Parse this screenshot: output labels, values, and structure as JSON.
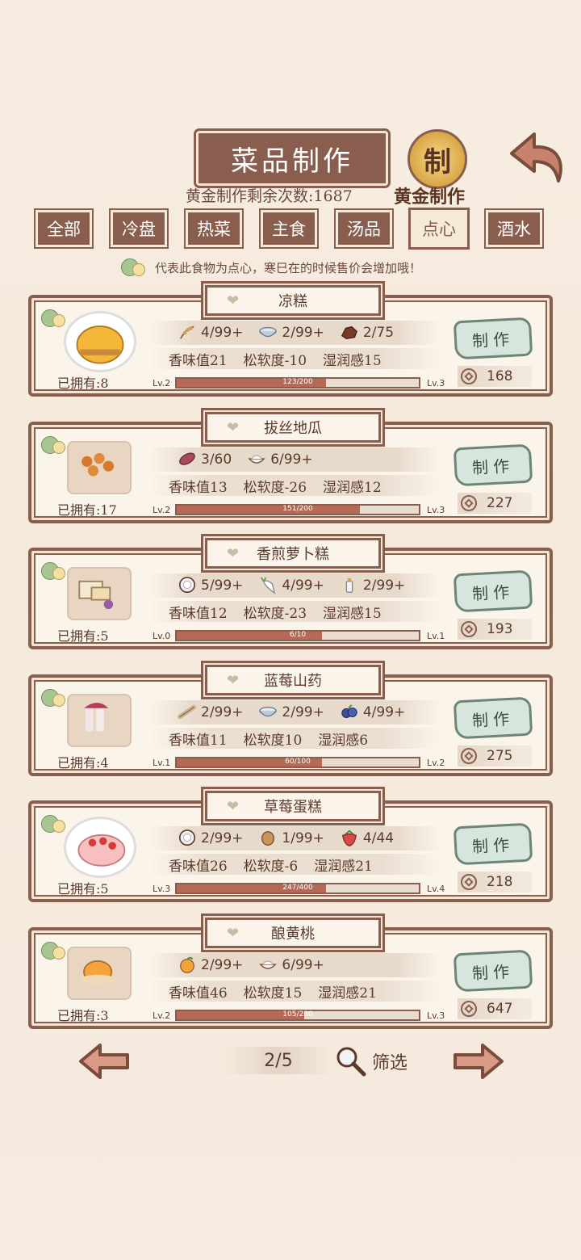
{
  "header": {
    "title": "菜品制作",
    "remaining_label": "黄金制作剩余次数:1687",
    "gold_badge_char": "制",
    "gold_label": "黄金制作"
  },
  "tabs": [
    {
      "label": "全部",
      "active": false
    },
    {
      "label": "冷盘",
      "active": false
    },
    {
      "label": "热菜",
      "active": false
    },
    {
      "label": "主食",
      "active": false
    },
    {
      "label": "汤品",
      "active": false
    },
    {
      "label": "点心",
      "active": true
    },
    {
      "label": "酒水",
      "active": false
    }
  ],
  "hint": "代表此食物为点心，寒巳在的时候售价会增加哦！",
  "recipes": [
    {
      "name": "凉糕",
      "owned": "已拥有:8",
      "ingredients": [
        {
          "icon": "grain-icon",
          "amount": "4/99+"
        },
        {
          "icon": "bowl-icon",
          "amount": "2/99+"
        },
        {
          "icon": "sugar-icon",
          "amount": "2/75"
        }
      ],
      "stats": [
        "香味值21",
        "松软度-10",
        "湿润感15"
      ],
      "lv_from": "Lv.2",
      "lv_to": "Lv.3",
      "progress_text": "123/200",
      "progress": 0.615,
      "make_label": "制作",
      "price": "168"
    },
    {
      "name": "拔丝地瓜",
      "owned": "已拥有:17",
      "ingredients": [
        {
          "icon": "sweet-potato-icon",
          "amount": "3/60"
        },
        {
          "icon": "sugar-bowl-icon",
          "amount": "6/99+"
        }
      ],
      "stats": [
        "香味值13",
        "松软度-26",
        "湿润感12"
      ],
      "lv_from": "Lv.2",
      "lv_to": "Lv.3",
      "progress_text": "151/200",
      "progress": 0.755,
      "make_label": "制作",
      "price": "227"
    },
    {
      "name": "香煎萝卜糕",
      "owned": "已拥有:5",
      "ingredients": [
        {
          "icon": "flour-icon",
          "amount": "5/99+"
        },
        {
          "icon": "radish-icon",
          "amount": "4/99+"
        },
        {
          "icon": "oil-bottle-icon",
          "amount": "2/99+"
        }
      ],
      "stats": [
        "香味值12",
        "松软度-23",
        "湿润感15"
      ],
      "lv_from": "Lv.0",
      "lv_to": "Lv.1",
      "progress_text": "6/10",
      "progress": 0.6,
      "make_label": "制作",
      "price": "193"
    },
    {
      "name": "蓝莓山药",
      "owned": "已拥有:4",
      "ingredients": [
        {
          "icon": "yam-icon",
          "amount": "2/99+"
        },
        {
          "icon": "bowl-icon",
          "amount": "2/99+"
        },
        {
          "icon": "blueberry-icon",
          "amount": "4/99+"
        }
      ],
      "stats": [
        "香味值11",
        "松软度10",
        "湿润感6"
      ],
      "lv_from": "Lv.1",
      "lv_to": "Lv.2",
      "progress_text": "60/100",
      "progress": 0.6,
      "make_label": "制作",
      "price": "275"
    },
    {
      "name": "草莓蛋糕",
      "owned": "已拥有:5",
      "ingredients": [
        {
          "icon": "flour-icon",
          "amount": "2/99+"
        },
        {
          "icon": "egg-icon",
          "amount": "1/99+"
        },
        {
          "icon": "strawberry-icon",
          "amount": "4/44"
        }
      ],
      "stats": [
        "香味值26",
        "松软度-6",
        "湿润感21"
      ],
      "lv_from": "Lv.3",
      "lv_to": "Lv.4",
      "progress_text": "247/400",
      "progress": 0.6175,
      "make_label": "制作",
      "price": "218"
    },
    {
      "name": "酿黄桃",
      "owned": "已拥有:3",
      "ingredients": [
        {
          "icon": "peach-icon",
          "amount": "2/99+"
        },
        {
          "icon": "sugar-bowl-icon",
          "amount": "6/99+"
        }
      ],
      "stats": [
        "香味值46",
        "松软度15",
        "湿润感21"
      ],
      "lv_from": "Lv.2",
      "lv_to": "Lv.3",
      "progress_text": "105/200",
      "progress": 0.525,
      "make_label": "制作",
      "price": "647"
    }
  ],
  "pager": {
    "page": "2/5",
    "filter_label": "筛选"
  }
}
